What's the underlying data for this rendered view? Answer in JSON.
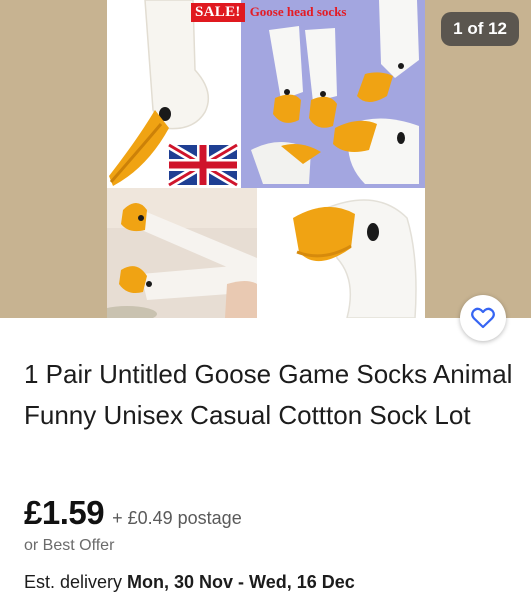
{
  "gallery": {
    "sale_label": "SALE!",
    "sale_subtitle": "Goose head socks",
    "counter": "1 of 12",
    "favorite_icon": "heart-icon",
    "colors": {
      "background": "#c7b391",
      "sale_red": "#e0191f",
      "favorite_blue": "#3665f3"
    }
  },
  "listing": {
    "title": "1 Pair Untitled Goose Game Socks Animal Funny Unisex Casual Cottton Sock Lot",
    "price": "£1.59",
    "postage": "+ £0.49 postage",
    "offer": "or Best Offer",
    "delivery_prefix": "Est. delivery",
    "delivery_dates": "Mon, 30 Nov - Wed, 16 Dec"
  }
}
